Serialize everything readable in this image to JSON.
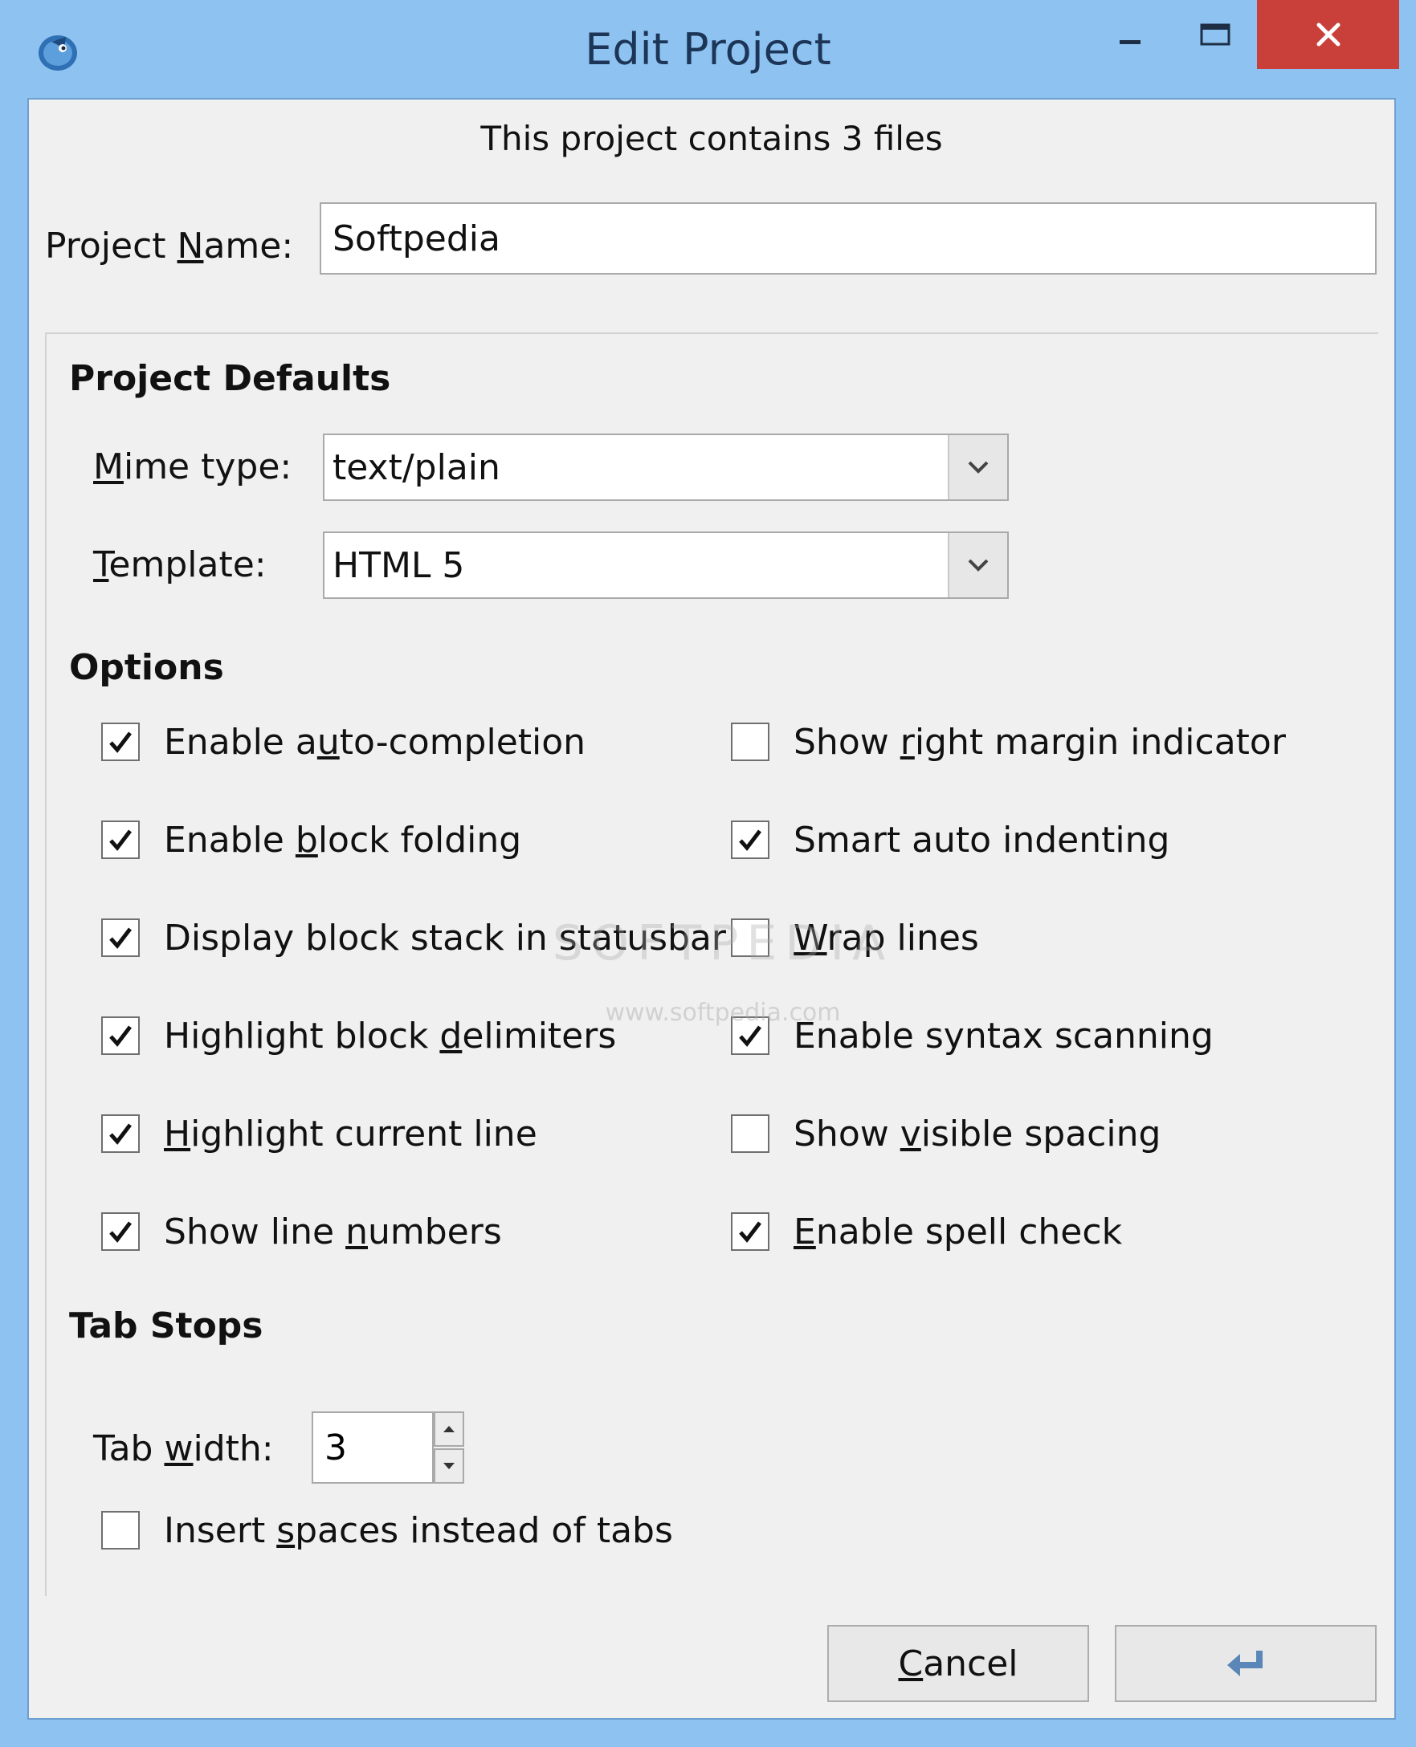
{
  "window": {
    "title": "Edit Project",
    "controls": {
      "minimize": "minimize",
      "maximize": "maximize",
      "close": "close"
    }
  },
  "info_text": "This project contains 3 files",
  "project_name": {
    "label_pre": "Project ",
    "label_u": "N",
    "label_post": "ame:",
    "value": "Softpedia"
  },
  "defaults": {
    "heading": "Project Defaults",
    "mime": {
      "label_u": "M",
      "label_post": "ime type:",
      "value": "text/plain"
    },
    "template": {
      "label_u": "T",
      "label_post": "emplate:",
      "value": "HTML 5"
    }
  },
  "options": {
    "heading": "Options",
    "left": [
      {
        "pre": "Enable a",
        "u": "u",
        "post": "to-completion",
        "checked": true
      },
      {
        "pre": "Enable ",
        "u": "b",
        "post": "lock folding",
        "checked": true
      },
      {
        "pre": "Display block stack in statusbar",
        "u": "",
        "post": "",
        "checked": true
      },
      {
        "pre": "Highlight block ",
        "u": "d",
        "post": "elimiters",
        "checked": true
      },
      {
        "pre": "",
        "u": "H",
        "post": "ighlight current line",
        "checked": true
      },
      {
        "pre": "Show line ",
        "u": "n",
        "post": "umbers",
        "checked": true
      }
    ],
    "right": [
      {
        "pre": "Show ",
        "u": "r",
        "post": "ight margin indicator",
        "checked": false
      },
      {
        "pre": "Smart auto indenting",
        "u": "",
        "post": "",
        "checked": true
      },
      {
        "pre": "",
        "u": "W",
        "post": "rap lines",
        "checked": false
      },
      {
        "pre": "Enable syntax scanning",
        "u": "",
        "post": "",
        "checked": true
      },
      {
        "pre": "Show ",
        "u": "v",
        "post": "isible spacing",
        "checked": false
      },
      {
        "pre": "",
        "u": "E",
        "post": "nable spell check",
        "checked": true
      }
    ]
  },
  "tabstops": {
    "heading": "Tab Stops",
    "width": {
      "label_pre": "Tab ",
      "label_u": "w",
      "label_post": "idth:",
      "value": "3"
    },
    "insert_spaces": {
      "pre": "Insert ",
      "u": "s",
      "post": "paces instead of tabs",
      "checked": false
    }
  },
  "buttons": {
    "cancel": {
      "u": "C",
      "post": "ancel"
    },
    "ok_icon": "enter-arrow-icon"
  },
  "watermark": {
    "main": "SOFTPEDIA",
    "sub": "www.softpedia.com"
  },
  "colors": {
    "titlebar": "#8ec3f1",
    "close": "#c9403a",
    "client": "#f0f0f0"
  }
}
